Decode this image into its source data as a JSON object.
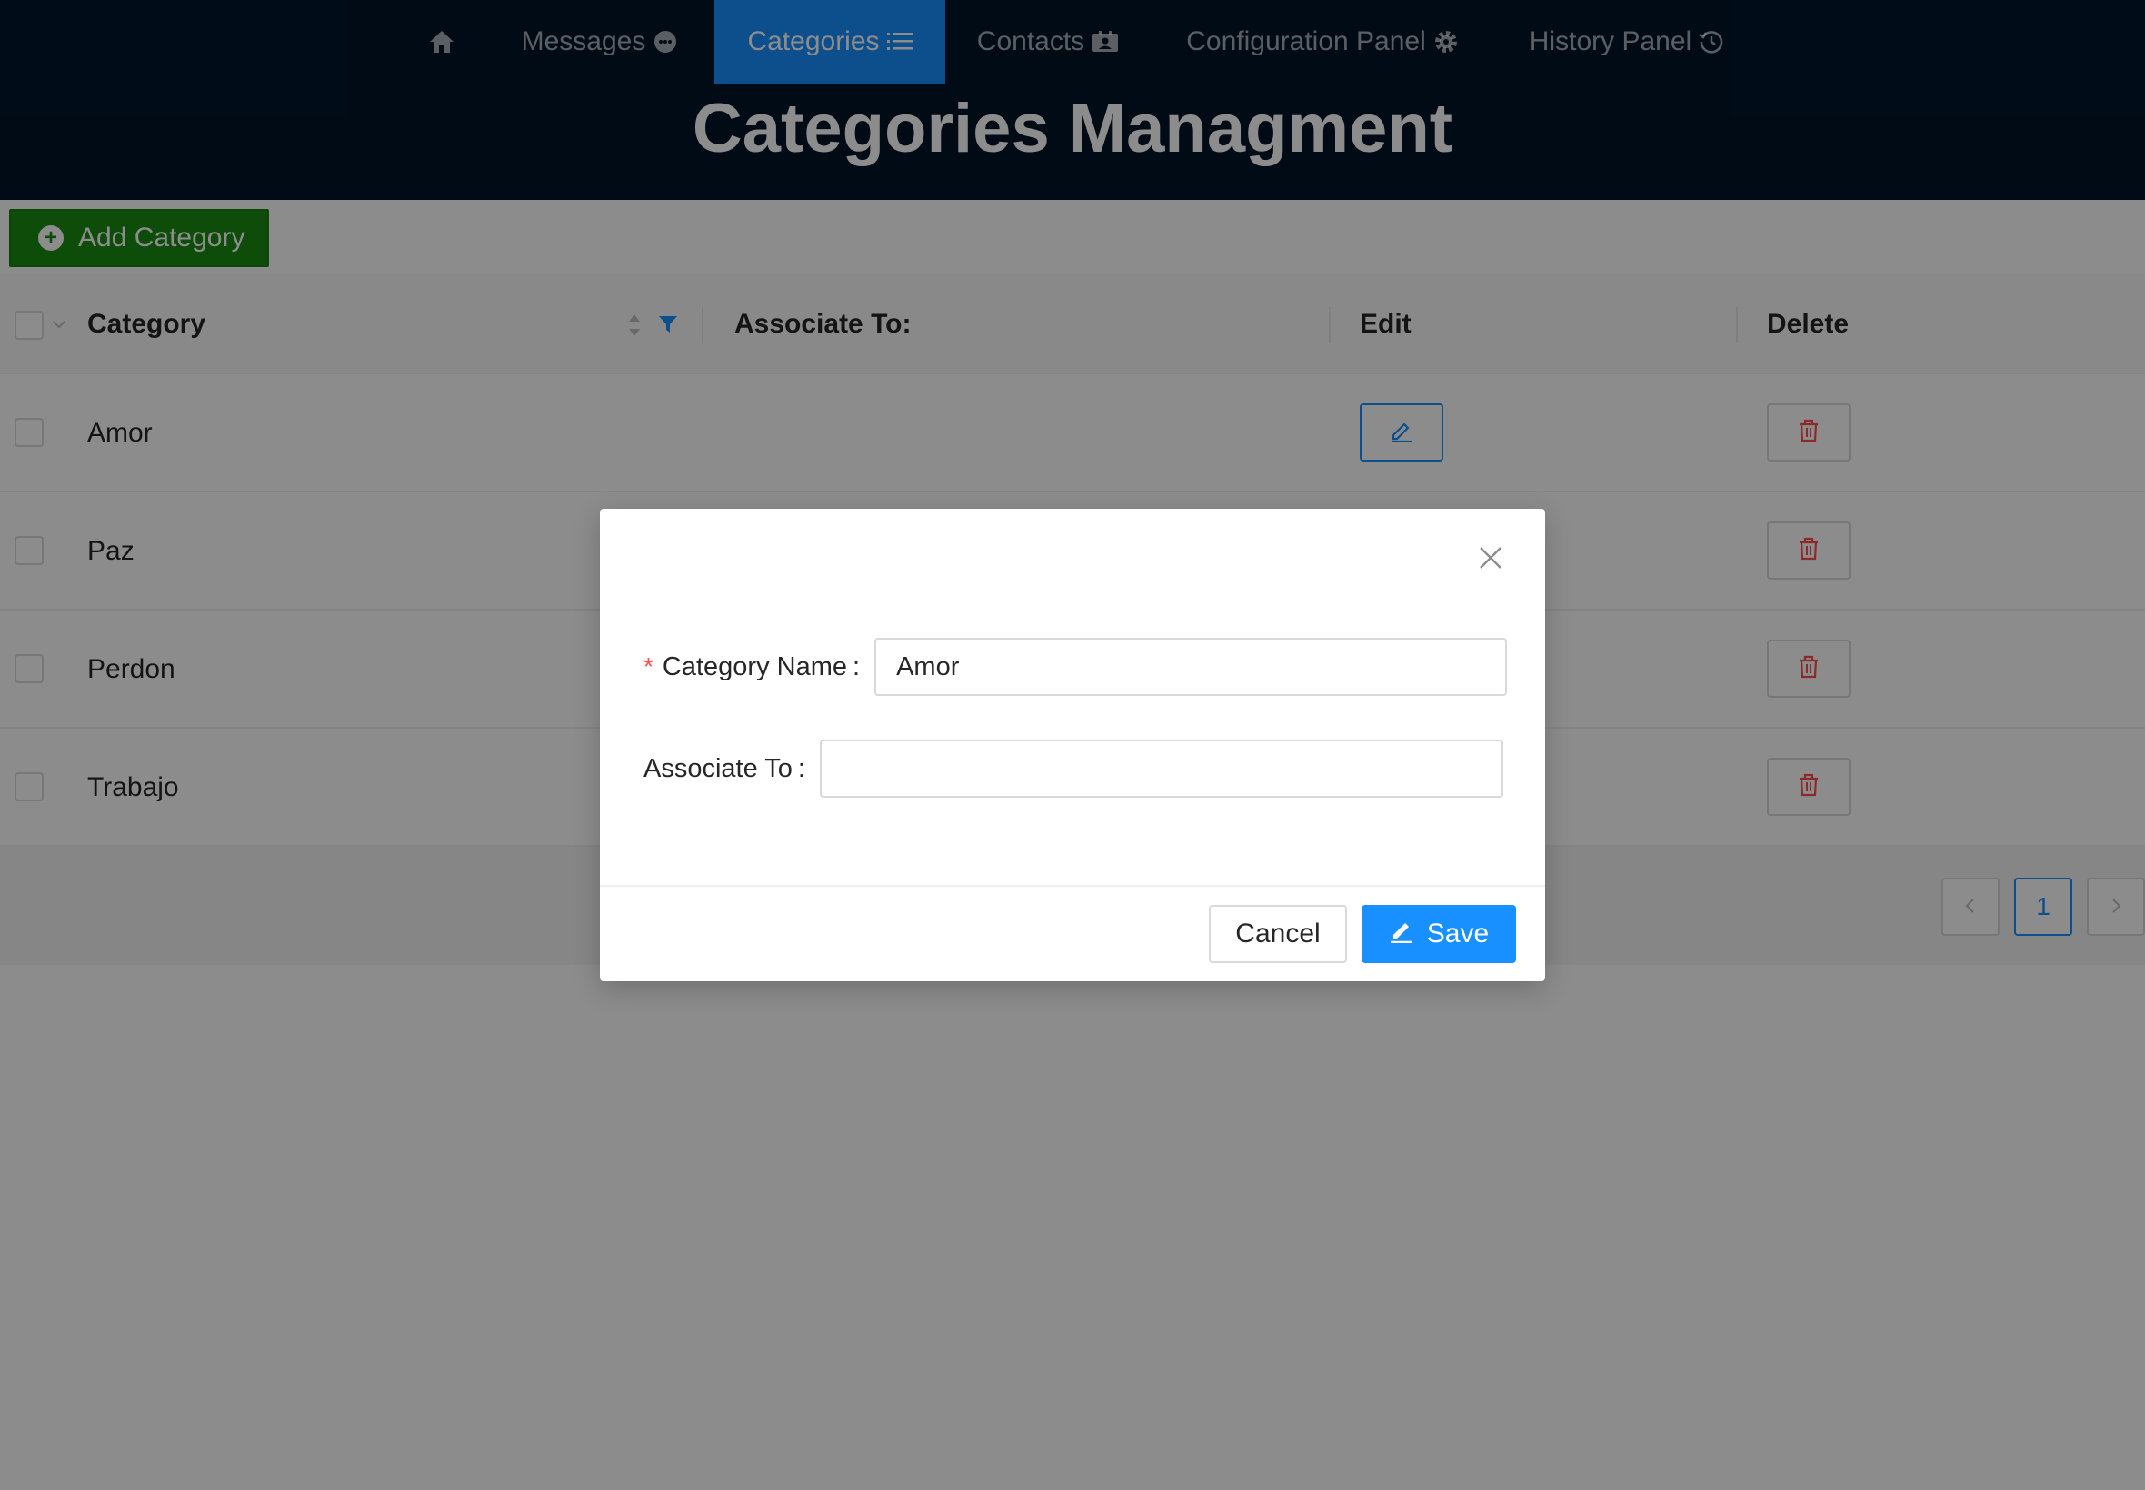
{
  "nav": {
    "items": [
      {
        "label": "",
        "icon": "home-icon"
      },
      {
        "label": "Messages",
        "icon": "message-icon"
      },
      {
        "label": "Categories",
        "icon": "list-icon",
        "active": true
      },
      {
        "label": "Contacts",
        "icon": "contacts-icon"
      },
      {
        "label": "Configuration Panel",
        "icon": "gear-icon"
      },
      {
        "label": "History Panel",
        "icon": "history-icon"
      }
    ]
  },
  "page": {
    "title": "Categories Managment"
  },
  "toolbar": {
    "add_label": "Add Category"
  },
  "table": {
    "columns": [
      "Category",
      "Associate To:",
      "Edit",
      "Delete"
    ],
    "rows": [
      {
        "category": "Amor",
        "associate_to": ""
      },
      {
        "category": "Paz",
        "associate_to": ""
      },
      {
        "category": "Perdon",
        "associate_to": ""
      },
      {
        "category": "Trabajo",
        "associate_to": ""
      }
    ]
  },
  "pagination": {
    "current_page": "1"
  },
  "modal": {
    "category_name_label": "Category Name",
    "category_name_value": "Amor",
    "associate_to_label": "Associate To",
    "associate_to_value": "",
    "cancel_label": "Cancel",
    "save_label": "Save"
  },
  "colors": {
    "header_bg": "#001529",
    "accent": "#1890ff",
    "add_button": "#1a8a12",
    "danger": "#ff4d4f"
  }
}
